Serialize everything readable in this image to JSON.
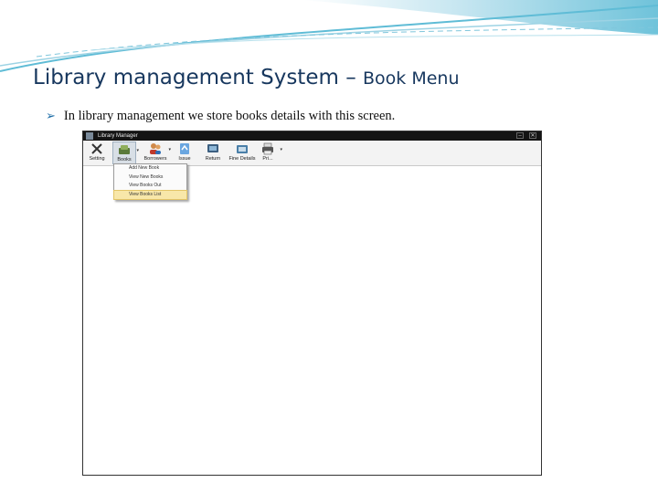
{
  "slide": {
    "title_main": "Library management System",
    "title_dash": " – ",
    "title_sub": "Book Menu",
    "bullet": "In library management we store books details with this screen."
  },
  "app": {
    "window_title": "Library Manager",
    "toolbar": [
      {
        "label": "Setting",
        "icon": "wrench-icon"
      },
      {
        "label": "Books",
        "icon": "books-icon"
      },
      {
        "label": "Borrowers",
        "icon": "users-icon"
      },
      {
        "label": "Issue",
        "icon": "issue-icon"
      },
      {
        "label": "Return",
        "icon": "return-icon"
      },
      {
        "label": "Fine Details",
        "icon": "fine-icon"
      },
      {
        "label": "Pri...",
        "icon": "printer-icon"
      }
    ],
    "books_menu": [
      {
        "label": "Add New Book",
        "selected": false
      },
      {
        "label": "View New Books",
        "selected": false
      },
      {
        "label": "View Books Out",
        "selected": false
      },
      {
        "label": "View Books List",
        "selected": true
      }
    ]
  },
  "colors": {
    "title": "#17375e",
    "bullet_arrow": "#1f6fa8",
    "menu_highlight": "#f8e7a9",
    "titlebar": "#141414"
  }
}
